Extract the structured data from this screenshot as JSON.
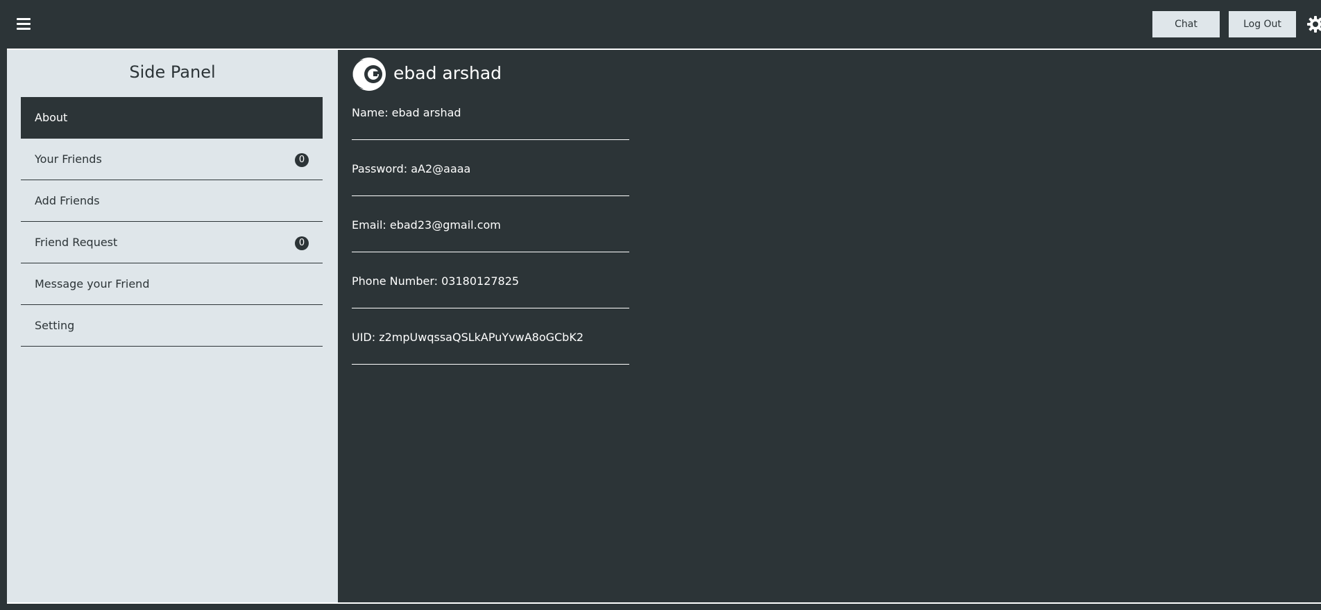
{
  "topbar": {
    "menu_icon": "hamburger-menu-icon",
    "chat_label": "Chat",
    "logout_label": "Log Out",
    "settings_icon": "gear-icon"
  },
  "sidepanel": {
    "title": "Side Panel",
    "items": [
      {
        "label": "About",
        "active": true
      },
      {
        "label": "Your Friends",
        "badge": "0"
      },
      {
        "label": "Add Friends"
      },
      {
        "label": "Friend Request",
        "badge": "0"
      },
      {
        "label": "Message your Friend"
      },
      {
        "label": "Setting"
      }
    ]
  },
  "profile": {
    "avatar_icon": "profile-avatar-icon",
    "name": "ebad arshad",
    "fields": [
      {
        "text": "Name: ebad arshad"
      },
      {
        "text": "Password: aA2@aaaa"
      },
      {
        "text": "Email: ebad23@gmail.com"
      },
      {
        "text": "Phone Number: 03180127825"
      },
      {
        "text": "UID: z2mpUwqssaQSLkAPuYvwA8oGCbK2"
      }
    ]
  },
  "colors": {
    "dark": "#2c3437",
    "light": "#dfe6ea",
    "white": "#ffffff"
  }
}
